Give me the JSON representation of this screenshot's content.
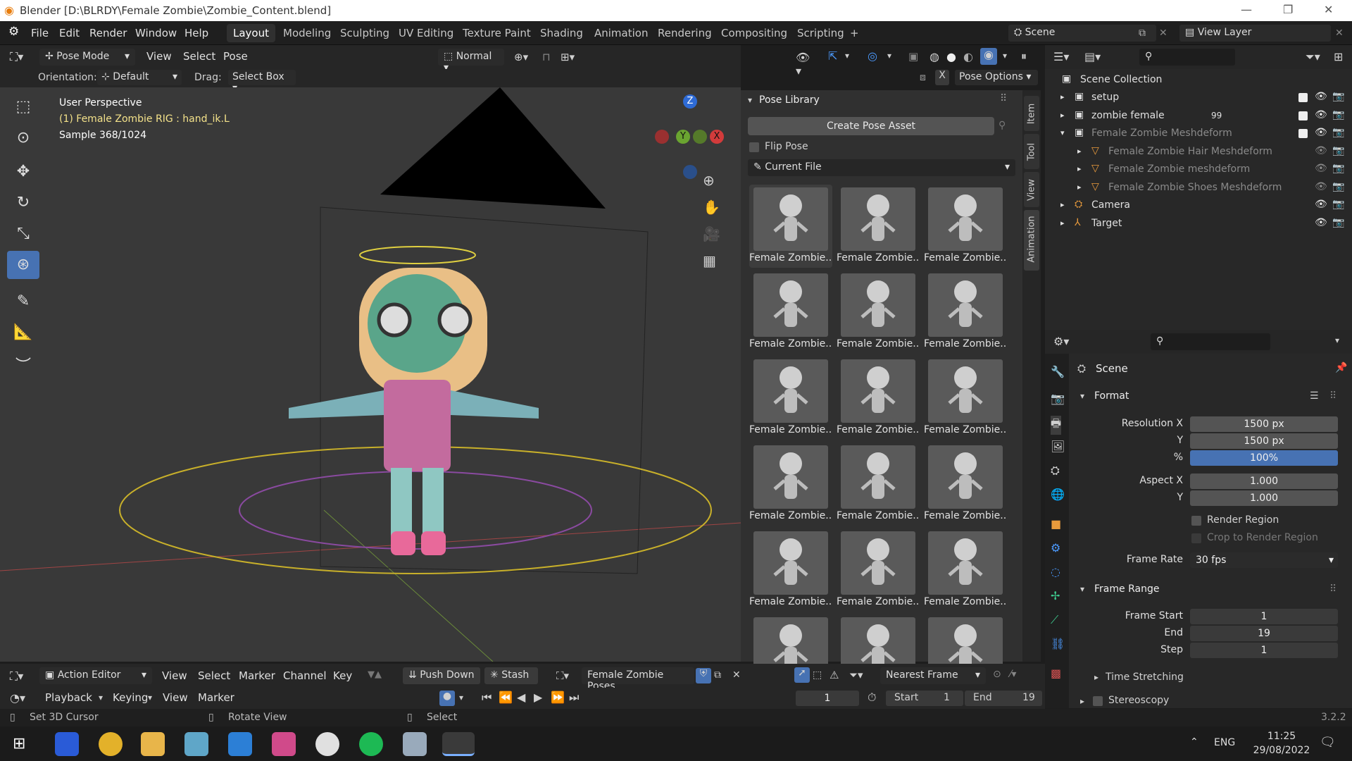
{
  "window": {
    "title": "Blender [D:\\BLRDY\\Female Zombie\\Zombie_Content.blend]"
  },
  "menu": {
    "file": "File",
    "edit": "Edit",
    "render": "Render",
    "window": "Window",
    "help": "Help"
  },
  "workspaces": [
    "Layout",
    "Modeling",
    "Sculpting",
    "UV Editing",
    "Texture Paint",
    "Shading",
    "Animation",
    "Rendering",
    "Compositing",
    "Scripting"
  ],
  "workspace_add": "+",
  "scene": {
    "label": "Scene",
    "view_layer": "View Layer"
  },
  "viewport": {
    "mode": "Pose Mode",
    "menus": [
      "View",
      "Select",
      "Pose"
    ],
    "transform": "Normal",
    "orientation_label": "Orientation:",
    "orientation": "Default",
    "drag_label": "Drag:",
    "drag": "Select Box",
    "pose_options": "Pose Options",
    "x_mirror": "X",
    "info_perspective": "User Perspective",
    "info_object": "(1) Female Zombie RIG : hand_ik.L",
    "info_sample": "Sample 368/1024",
    "gizmo": {
      "z": "Z",
      "y": "Y",
      "x": "X"
    }
  },
  "pose_library": {
    "title": "Pose Library",
    "create_button": "Create Pose Asset",
    "flip_pose": "Flip Pose",
    "library": "Current File",
    "thumb_label": "Female Zombie...",
    "thumb_count": 18
  },
  "side_tabs": [
    "Item",
    "Tool",
    "View",
    "Animation"
  ],
  "outliner": {
    "root": "Scene Collection",
    "items": [
      {
        "name": "setup",
        "level": 1
      },
      {
        "name": "zombie female",
        "level": 1,
        "count": "99"
      },
      {
        "name": "Female Zombie Meshdeform",
        "level": 1
      },
      {
        "name": "Female Zombie Hair Meshdeform",
        "level": 2
      },
      {
        "name": "Female Zombie meshdeform",
        "level": 2
      },
      {
        "name": "Female Zombie Shoes Meshdeform",
        "level": 2
      },
      {
        "name": "Camera",
        "level": 1
      },
      {
        "name": "Target",
        "level": 1
      }
    ]
  },
  "properties": {
    "context": "Scene",
    "format_panel": "Format",
    "resolution_x_label": "Resolution X",
    "resolution_x": "1500 px",
    "resolution_y_label": "Y",
    "resolution_y": "1500 px",
    "percent_label": "%",
    "percent": "100%",
    "aspect_x_label": "Aspect X",
    "aspect_x": "1.000",
    "aspect_y_label": "Y",
    "aspect_y": "1.000",
    "render_region": "Render Region",
    "crop_region": "Crop to Render Region",
    "frame_rate_label": "Frame Rate",
    "frame_rate": "30 fps",
    "frame_range_panel": "Frame Range",
    "frame_start_label": "Frame Start",
    "frame_start": "1",
    "end_label": "End",
    "end": "19",
    "step_label": "Step",
    "step": "1",
    "time_stretching": "Time Stretching",
    "stereoscopy": "Stereoscopy"
  },
  "action_editor": {
    "editor": "Action Editor",
    "menus": [
      "View",
      "Select",
      "Marker",
      "Channel",
      "Key"
    ],
    "push_down": "Push Down",
    "stash": "Stash",
    "action": "Female Zombie Poses",
    "snap": "Nearest Frame"
  },
  "timeline": {
    "playback": "Playback",
    "keying": "Keying",
    "view": "View",
    "marker": "Marker",
    "current_frame": "1",
    "start_label": "Start",
    "start": "1",
    "end_label": "End",
    "end": "19"
  },
  "statusbar": {
    "left": "Set 3D Cursor",
    "mid": "Rotate View",
    "right": "Select",
    "version": "3.2.2"
  },
  "taskbar": {
    "lang": "ENG",
    "time": "11:25",
    "date": "29/08/2022"
  }
}
